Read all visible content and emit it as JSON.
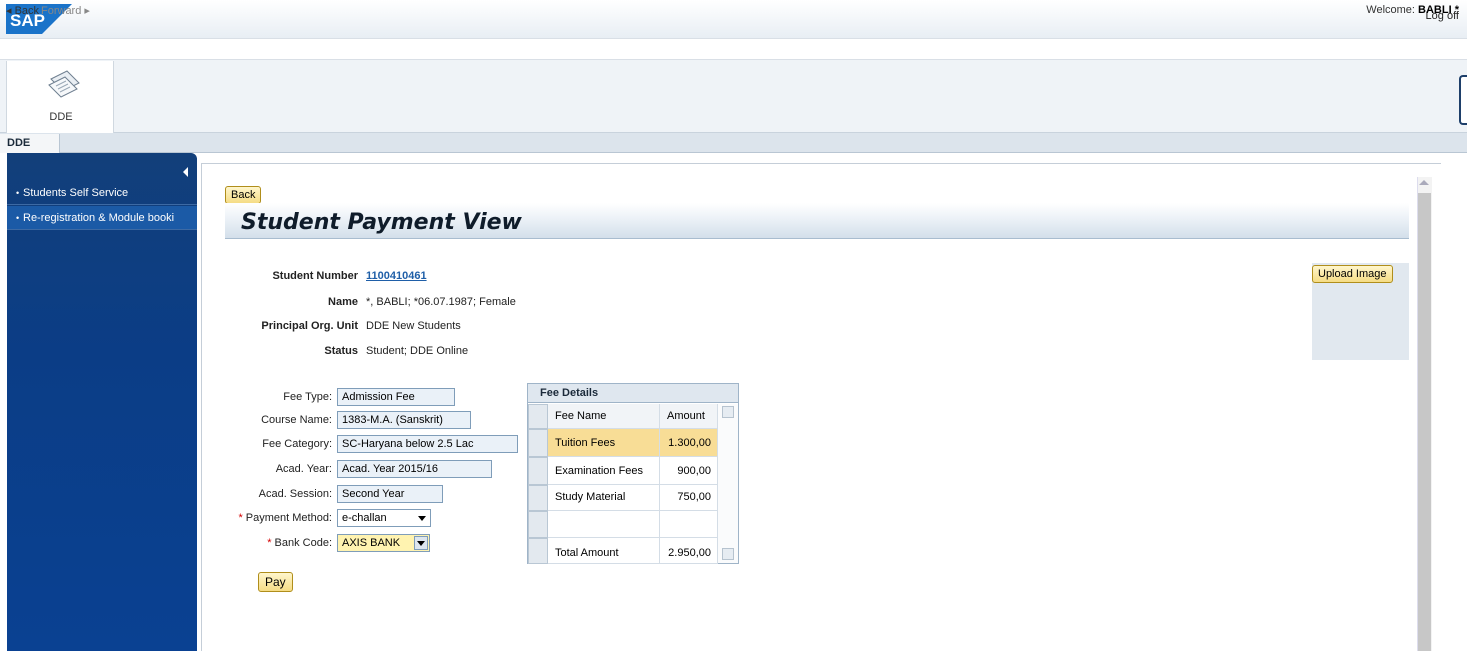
{
  "header": {
    "logo_text": "SAP",
    "logoff_label": "Log off",
    "back_label": "◂ Back",
    "forward_label": "Forward ▸",
    "welcome_prefix": "Welcome: ",
    "welcome_user": "BABLI *"
  },
  "workset": {
    "tile_label": "DDE",
    "subtab_label": "DDE"
  },
  "sidebar": {
    "items": [
      {
        "label": "Students Self Service"
      },
      {
        "label": "Re-registration & Module booki"
      }
    ]
  },
  "page": {
    "back_button": "Back",
    "title": "Student Payment View",
    "upload_button": "Upload Image"
  },
  "student": {
    "number_label": "Student Number",
    "number_value": "1100410461",
    "name_label": "Name",
    "name_value": "*, BABLI; *06.07.1987; Female",
    "org_label": "Principal Org. Unit",
    "org_value": "DDE New Students",
    "status_label": "Status",
    "status_value": "Student; DDE Online"
  },
  "form": {
    "fee_type_label": "Fee Type:",
    "fee_type_value": "Admission Fee",
    "course_label": "Course Name:",
    "course_value": "1383-M.A. (Sanskrit)",
    "category_label": "Fee Category:",
    "category_value": "SC-Haryana below 2.5 Lac",
    "acad_year_label": "Acad. Year:",
    "acad_year_value": "Acad. Year 2015/16",
    "session_label": "Acad. Session:",
    "session_value": "Second Year",
    "payment_label": "Payment Method:",
    "payment_value": "e-challan",
    "bank_label": "Bank Code:",
    "bank_value": "AXIS BANK",
    "required_mark": "*",
    "pay_button": "Pay"
  },
  "fee_details": {
    "title": "Fee Details",
    "columns": [
      "Fee Name",
      "Amount"
    ],
    "rows": [
      {
        "name": "Tuition Fees",
        "amount": "1.300,00"
      },
      {
        "name": "Examination Fees",
        "amount": "900,00"
      },
      {
        "name": "Study Material",
        "amount": "750,00"
      },
      {
        "name": "",
        "amount": ""
      },
      {
        "name": "Total Amount",
        "amount": "2.950,00"
      }
    ]
  },
  "colors": {
    "nav_blue": "#0b3d86",
    "button_yellow": "#f5dc85",
    "selected_row": "#f8dd96",
    "required_red": "#d40000"
  }
}
